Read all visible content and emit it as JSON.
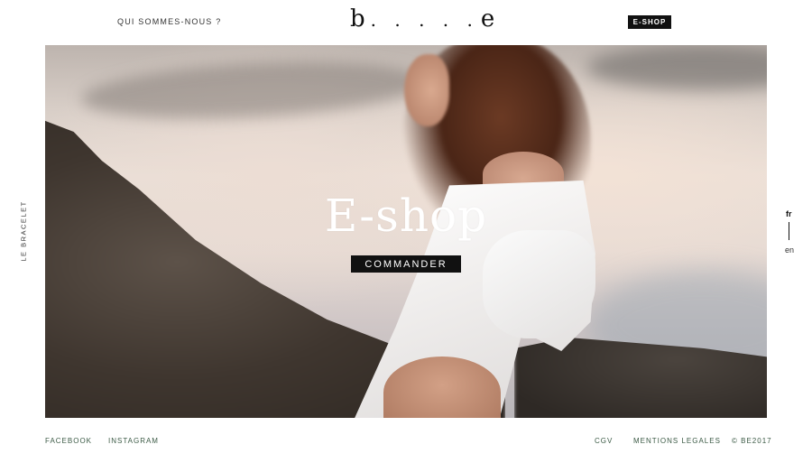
{
  "header": {
    "nav_about": "QUI SOMMES-NOUS ?",
    "logo_first": "b",
    "logo_dots": ". . . . .",
    "logo_last": "e",
    "eshop_label": "E-SHOP"
  },
  "hero": {
    "title": "E-shop",
    "cta_label": "COMMANDER"
  },
  "side": {
    "left_label": "LE BRACELET",
    "lang_active": "fr",
    "lang_other": "en"
  },
  "footer": {
    "facebook": "FACEBOOK",
    "instagram": "INSTAGRAM",
    "cgv": "CGV",
    "legal": "MENTIONS LEGALES",
    "copyright": "© BE2017"
  },
  "colors": {
    "footer_link": "#3b5a45",
    "button_bg": "#111111"
  }
}
